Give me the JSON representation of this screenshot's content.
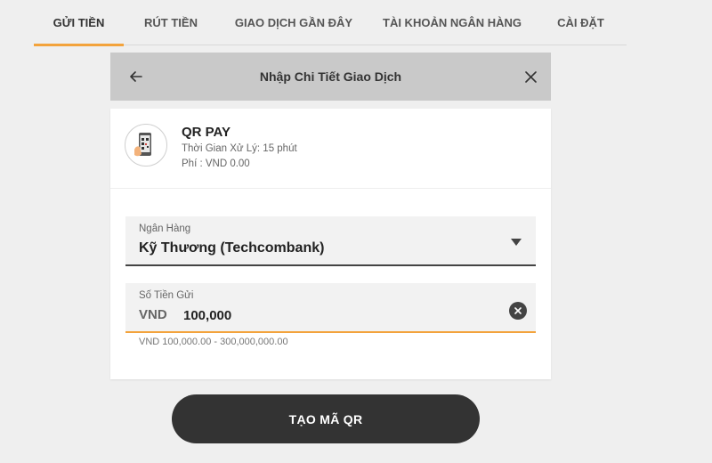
{
  "tabs": [
    {
      "label": "GỬI TIỀN",
      "active": true
    },
    {
      "label": "RÚT TIỀN",
      "active": false
    },
    {
      "label": "GIAO DỊCH GẦN ĐÂY",
      "active": false
    },
    {
      "label": "TÀI KHOẢN NGÂN HÀNG",
      "active": false
    },
    {
      "label": "CÀI ĐẶT",
      "active": false
    }
  ],
  "modal": {
    "title": "Nhập Chi Tiết Giao Dịch",
    "back_icon": "arrow-left-icon",
    "close_icon": "close-icon"
  },
  "method": {
    "icon": "qr-phone-icon",
    "name": "QR PAY",
    "processing_time": "Thời Gian Xử Lý: 15 phút",
    "fee": "Phí : VND 0.00"
  },
  "bank_select": {
    "label": "Ngân Hàng",
    "value": "Kỹ Thương (Techcombank)"
  },
  "amount": {
    "label": "Số Tiền Gửi",
    "currency": "VND",
    "value": "100,000",
    "range_hint": "VND 100,000.00 - 300,000,000.00"
  },
  "submit": {
    "label": "TẠO MÃ QR"
  },
  "colors": {
    "accent": "#f3a33c",
    "header_bg": "#c9c9c9",
    "button_bg": "#333333",
    "page_bg": "#efefef"
  }
}
